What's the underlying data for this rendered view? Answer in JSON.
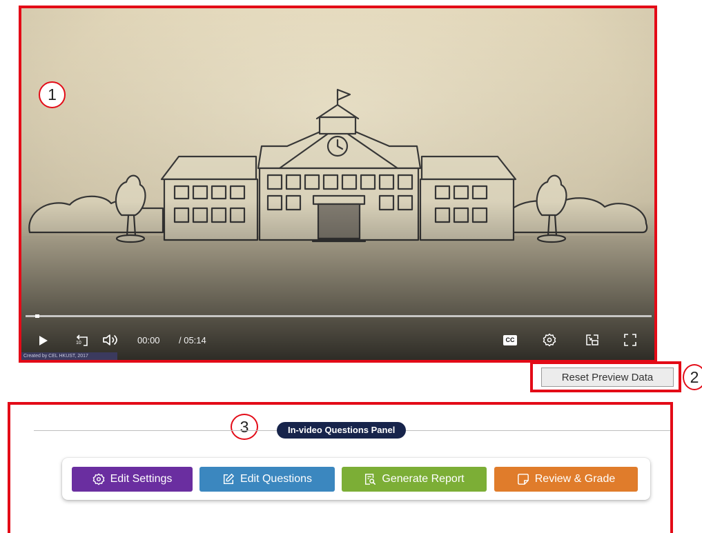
{
  "player": {
    "current_time": "00:00",
    "duration": "/ 05:14",
    "credit": "Created by CEL HKUST, 2017",
    "progress": 0,
    "icons": [
      "play-icon",
      "rewind-10-icon",
      "volume-icon",
      "captions-icon",
      "settings-icon",
      "picture-in-picture-icon",
      "fullscreen-icon"
    ],
    "rewind_label": "10",
    "captions_label": "CC"
  },
  "markers": [
    "1",
    "2",
    "3"
  ],
  "reset": {
    "label": "Reset Preview Data"
  },
  "panel": {
    "title": "In-video Questions Panel",
    "buttons": [
      {
        "label": "Edit Settings",
        "icon": "gear-icon",
        "color": "#6a2ea0"
      },
      {
        "label": "Edit Questions",
        "icon": "pencil-square-icon",
        "color": "#3b87bf"
      },
      {
        "label": "Generate Report",
        "icon": "report-search-icon",
        "color": "#7cae36"
      },
      {
        "label": "Review & Grade",
        "icon": "note-icon",
        "color": "#e07c2b"
      }
    ]
  }
}
